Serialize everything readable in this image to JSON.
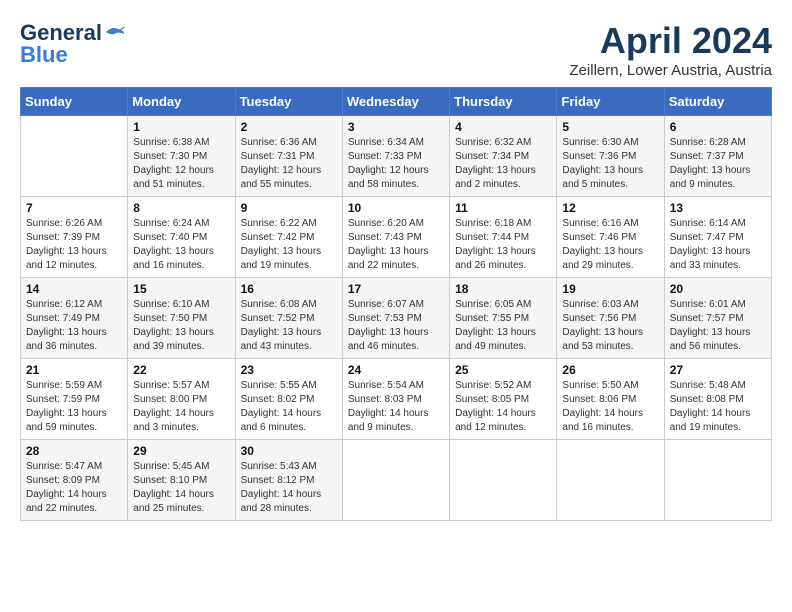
{
  "header": {
    "logo_line1": "General",
    "logo_line2": "Blue",
    "month": "April 2024",
    "location": "Zeillern, Lower Austria, Austria"
  },
  "weekdays": [
    "Sunday",
    "Monday",
    "Tuesday",
    "Wednesday",
    "Thursday",
    "Friday",
    "Saturday"
  ],
  "weeks": [
    [
      {
        "day": "",
        "info": ""
      },
      {
        "day": "1",
        "info": "Sunrise: 6:38 AM\nSunset: 7:30 PM\nDaylight: 12 hours\nand 51 minutes."
      },
      {
        "day": "2",
        "info": "Sunrise: 6:36 AM\nSunset: 7:31 PM\nDaylight: 12 hours\nand 55 minutes."
      },
      {
        "day": "3",
        "info": "Sunrise: 6:34 AM\nSunset: 7:33 PM\nDaylight: 12 hours\nand 58 minutes."
      },
      {
        "day": "4",
        "info": "Sunrise: 6:32 AM\nSunset: 7:34 PM\nDaylight: 13 hours\nand 2 minutes."
      },
      {
        "day": "5",
        "info": "Sunrise: 6:30 AM\nSunset: 7:36 PM\nDaylight: 13 hours\nand 5 minutes."
      },
      {
        "day": "6",
        "info": "Sunrise: 6:28 AM\nSunset: 7:37 PM\nDaylight: 13 hours\nand 9 minutes."
      }
    ],
    [
      {
        "day": "7",
        "info": "Sunrise: 6:26 AM\nSunset: 7:39 PM\nDaylight: 13 hours\nand 12 minutes."
      },
      {
        "day": "8",
        "info": "Sunrise: 6:24 AM\nSunset: 7:40 PM\nDaylight: 13 hours\nand 16 minutes."
      },
      {
        "day": "9",
        "info": "Sunrise: 6:22 AM\nSunset: 7:42 PM\nDaylight: 13 hours\nand 19 minutes."
      },
      {
        "day": "10",
        "info": "Sunrise: 6:20 AM\nSunset: 7:43 PM\nDaylight: 13 hours\nand 22 minutes."
      },
      {
        "day": "11",
        "info": "Sunrise: 6:18 AM\nSunset: 7:44 PM\nDaylight: 13 hours\nand 26 minutes."
      },
      {
        "day": "12",
        "info": "Sunrise: 6:16 AM\nSunset: 7:46 PM\nDaylight: 13 hours\nand 29 minutes."
      },
      {
        "day": "13",
        "info": "Sunrise: 6:14 AM\nSunset: 7:47 PM\nDaylight: 13 hours\nand 33 minutes."
      }
    ],
    [
      {
        "day": "14",
        "info": "Sunrise: 6:12 AM\nSunset: 7:49 PM\nDaylight: 13 hours\nand 36 minutes."
      },
      {
        "day": "15",
        "info": "Sunrise: 6:10 AM\nSunset: 7:50 PM\nDaylight: 13 hours\nand 39 minutes."
      },
      {
        "day": "16",
        "info": "Sunrise: 6:08 AM\nSunset: 7:52 PM\nDaylight: 13 hours\nand 43 minutes."
      },
      {
        "day": "17",
        "info": "Sunrise: 6:07 AM\nSunset: 7:53 PM\nDaylight: 13 hours\nand 46 minutes."
      },
      {
        "day": "18",
        "info": "Sunrise: 6:05 AM\nSunset: 7:55 PM\nDaylight: 13 hours\nand 49 minutes."
      },
      {
        "day": "19",
        "info": "Sunrise: 6:03 AM\nSunset: 7:56 PM\nDaylight: 13 hours\nand 53 minutes."
      },
      {
        "day": "20",
        "info": "Sunrise: 6:01 AM\nSunset: 7:57 PM\nDaylight: 13 hours\nand 56 minutes."
      }
    ],
    [
      {
        "day": "21",
        "info": "Sunrise: 5:59 AM\nSunset: 7:59 PM\nDaylight: 13 hours\nand 59 minutes."
      },
      {
        "day": "22",
        "info": "Sunrise: 5:57 AM\nSunset: 8:00 PM\nDaylight: 14 hours\nand 3 minutes."
      },
      {
        "day": "23",
        "info": "Sunrise: 5:55 AM\nSunset: 8:02 PM\nDaylight: 14 hours\nand 6 minutes."
      },
      {
        "day": "24",
        "info": "Sunrise: 5:54 AM\nSunset: 8:03 PM\nDaylight: 14 hours\nand 9 minutes."
      },
      {
        "day": "25",
        "info": "Sunrise: 5:52 AM\nSunset: 8:05 PM\nDaylight: 14 hours\nand 12 minutes."
      },
      {
        "day": "26",
        "info": "Sunrise: 5:50 AM\nSunset: 8:06 PM\nDaylight: 14 hours\nand 16 minutes."
      },
      {
        "day": "27",
        "info": "Sunrise: 5:48 AM\nSunset: 8:08 PM\nDaylight: 14 hours\nand 19 minutes."
      }
    ],
    [
      {
        "day": "28",
        "info": "Sunrise: 5:47 AM\nSunset: 8:09 PM\nDaylight: 14 hours\nand 22 minutes."
      },
      {
        "day": "29",
        "info": "Sunrise: 5:45 AM\nSunset: 8:10 PM\nDaylight: 14 hours\nand 25 minutes."
      },
      {
        "day": "30",
        "info": "Sunrise: 5:43 AM\nSunset: 8:12 PM\nDaylight: 14 hours\nand 28 minutes."
      },
      {
        "day": "",
        "info": ""
      },
      {
        "day": "",
        "info": ""
      },
      {
        "day": "",
        "info": ""
      },
      {
        "day": "",
        "info": ""
      }
    ]
  ]
}
